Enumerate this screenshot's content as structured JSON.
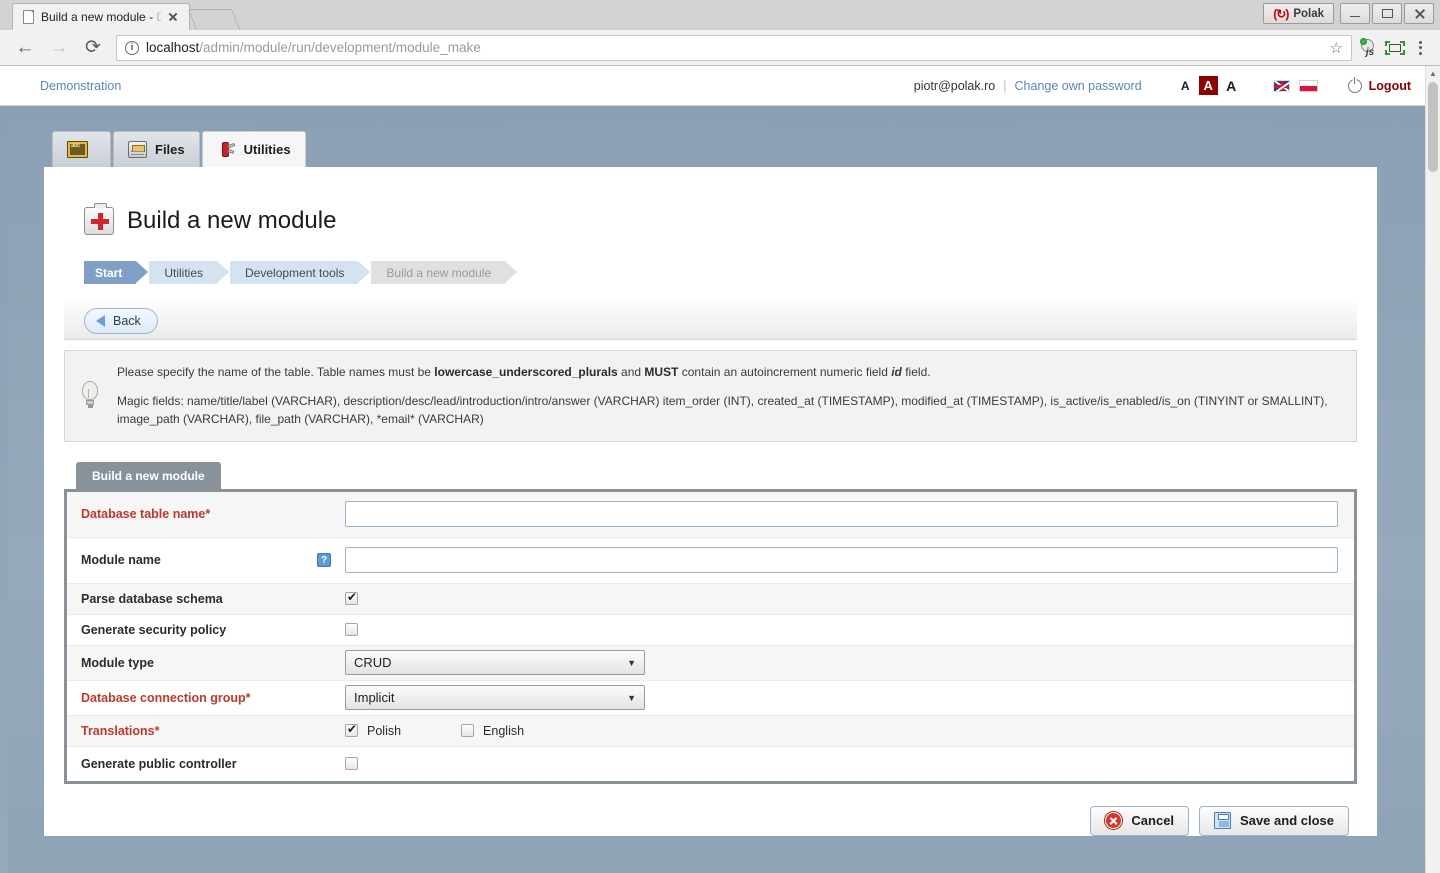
{
  "browser": {
    "tab_title": "Build a new module - De",
    "tab_title_main": "Build a new module - ",
    "tab_title_dim": "De",
    "url_host": "localhost",
    "url_path": "/admin/module/run/development/module_make",
    "window_app_label": "Polak",
    "icons": {
      "back": "←",
      "forward": "→",
      "reload": "C",
      "info": "i",
      "star": "☆",
      "js_ext": "js",
      "kebab": "⋮"
    }
  },
  "appheader": {
    "demo_link": "Demonstration",
    "user_email": "piotr@polak.ro",
    "separator": "|",
    "change_password": "Change own password",
    "font_small": "A",
    "font_medium": "A",
    "font_large": "A",
    "logout": "Logout"
  },
  "maintabs": [
    {
      "label": "",
      "icon": "blackboard-icon",
      "active": false
    },
    {
      "label": "Files",
      "icon": "files-icon",
      "active": false
    },
    {
      "label": "Utilities",
      "icon": "swiss-knife-icon",
      "active": true
    }
  ],
  "page": {
    "title": "Build a new module",
    "icon": "first-aid-kit-icon"
  },
  "breadcrumbs": [
    {
      "label": "Start"
    },
    {
      "label": "Utilities"
    },
    {
      "label": "Development tools"
    },
    {
      "label": "Build a new module"
    }
  ],
  "toolbar": {
    "back_label": "Back"
  },
  "info": {
    "line1_a": "Please specify the name of the table. Table names must be ",
    "line1_b": "lowercase_underscored_plurals",
    "line1_c": " and ",
    "line1_d": "MUST",
    "line1_e": " contain an autoincrement numeric field ",
    "line1_f": "id",
    "line1_g": " field.",
    "line2_prefix": "Magic fields: ",
    "magic_fields": "name/title/label (VARCHAR), description/desc/lead/introduction/intro/answer (VARCHAR) item_order (INT), created_at (TIMESTAMP), modified_at (TIMESTAMP), is_active/is_enabled/is_on (TINYINT or SMALLINT), image_path (VARCHAR), file_path (VARCHAR), *email* (VARCHAR)"
  },
  "form": {
    "tab_label": "Build a new module",
    "fields": {
      "table_name": {
        "label": "Database table name*",
        "value": "",
        "placeholder": ""
      },
      "module_name": {
        "label": "Module name",
        "value": "",
        "placeholder": "",
        "help": "?"
      },
      "parse_schema": {
        "label": "Parse database schema",
        "checked": true
      },
      "security_policy": {
        "label": "Generate security policy",
        "checked": false
      },
      "module_type": {
        "label": "Module type",
        "value": "CRUD",
        "caret": "▼"
      },
      "db_group": {
        "label": "Database connection group*",
        "value": "Implicit",
        "caret": "▼"
      },
      "translations": {
        "label": "Translations*",
        "options": [
          {
            "label": "Polish",
            "checked": true
          },
          {
            "label": "English",
            "checked": false
          }
        ]
      },
      "public_controller": {
        "label": "Generate public controller",
        "checked": false
      }
    }
  },
  "actions": {
    "cancel": "Cancel",
    "save": "Save and close"
  },
  "colors": {
    "accent_blue": "#5b84c4",
    "danger_red": "#c0392b",
    "logout_red": "#8b0000",
    "body_blue": "#97aabd",
    "formbox_border": "#8a9299"
  }
}
